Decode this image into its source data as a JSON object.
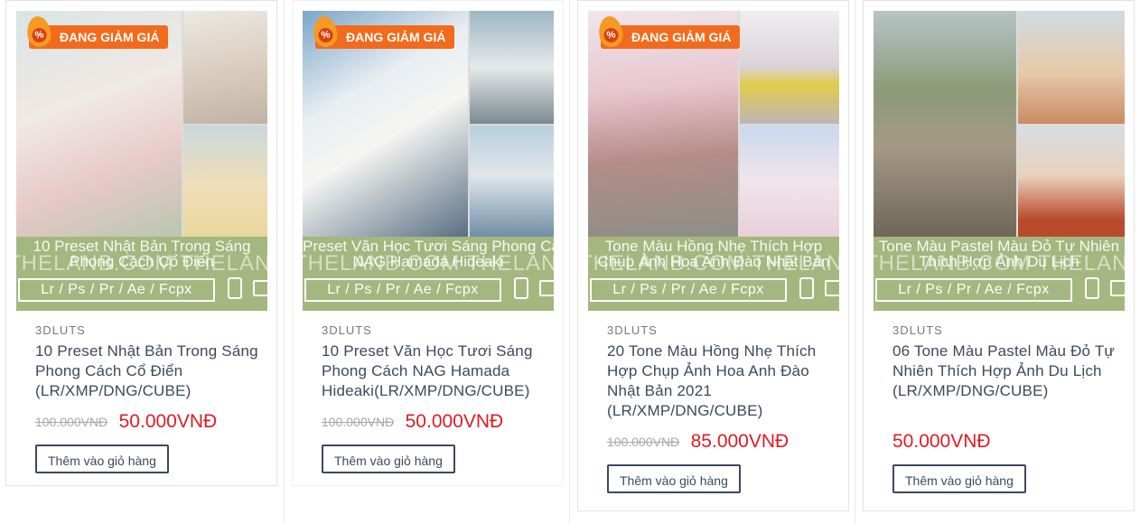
{
  "products": [
    {
      "badge": "ĐANG GIẢM GIÁ",
      "banner_title": "10 Preset Nhật Bản Trong Sáng",
      "banner_subtitle": "Phong Cách Cổ Điển",
      "watermark": "THELANB.COM THELANB.COM",
      "formats": "Lr / Ps / Pr / Ae / Fcpx",
      "category": "3DLUTS",
      "name": "10 Preset Nhật Bản Trong Sáng Phong Cách Cổ Điển (LR/XMP/DNG/CUBE)",
      "old_price": "100.000VNĐ",
      "new_price": "50.000VNĐ",
      "button": "Thêm vào giỏ hàng"
    },
    {
      "badge": "ĐANG GIẢM GIÁ",
      "banner_title": "Preset Văn Học Tươi Sáng Phong Cách",
      "banner_subtitle": "NAG Hamada Hideaki",
      "watermark": "THELANB.COM THELANB.COM",
      "formats": "Lr / Ps / Pr / Ae / Fcpx",
      "category": "3DLUTS",
      "name": "10 Preset Văn Học Tươi Sáng Phong Cách NAG Hamada Hideaki(LR/XMP/DNG/CUBE)",
      "old_price": "100.000VNĐ",
      "new_price": "50.000VNĐ",
      "button": "Thêm vào giỏ hàng"
    },
    {
      "badge": "ĐANG GIẢM GIÁ",
      "banner_title": "Tone Màu Hồng Nhẹ Thích Hợp",
      "banner_subtitle": "Chụp Ảnh Hoa Anh Đào Nhật Bản",
      "watermark": "THELANB.COM THELANB.COM",
      "formats": "Lr / Ps / Pr / Ae / Fcpx",
      "category": "3DLUTS",
      "name": "20 Tone Màu Hồng Nhẹ Thích Hợp Chụp Ảnh Hoa Anh Đào Nhật Bản 2021 (LR/XMP/DNG/CUBE)",
      "old_price": "100.000VNĐ",
      "new_price": "85.000VNĐ",
      "button": "Thêm vào giỏ hàng"
    },
    {
      "badge": "",
      "banner_title": "Tone Màu Pastel Màu Đỏ Tự Nhiên",
      "banner_subtitle": "Thích Hợp Ảnh Du Lịch",
      "watermark": "THELANB.COM THELANB.COM",
      "formats": "Lr / Ps / Pr / Ae / Fcpx",
      "category": "3DLUTS",
      "name": "06 Tone Màu Pastel Màu Đỏ Tự Nhiên Thích Hợp Ảnh Du Lịch (LR/XMP/DNG/CUBE)",
      "old_price": "",
      "new_price": "50.000VNĐ",
      "button": "Thêm vào giỏ hàng"
    }
  ],
  "colors": {
    "accent_red": "#e01b24",
    "badge_orange": "#f26b1d",
    "banner_green": "#a4b77f",
    "button_border": "#3b4a5e"
  }
}
